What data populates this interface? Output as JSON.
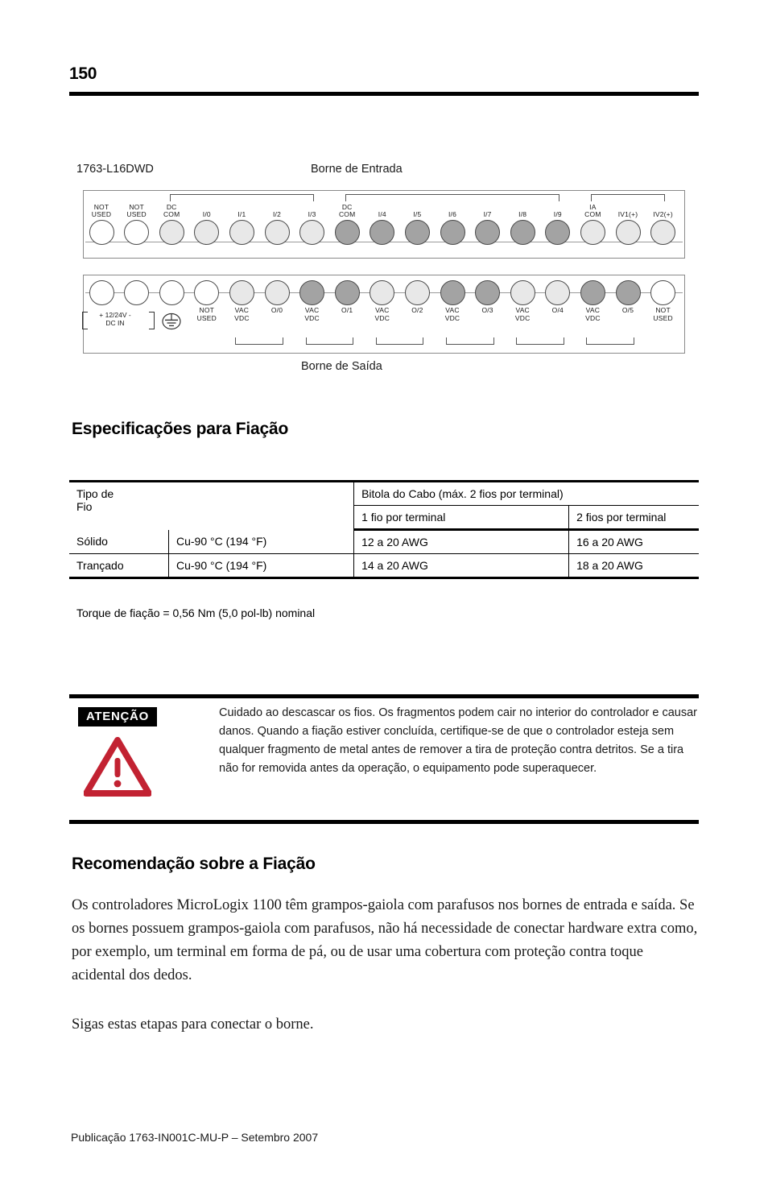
{
  "page": {
    "number": "150",
    "footer": "Publicação 1763-IN001C-MU-P – Setembro 2007"
  },
  "diagram": {
    "model": "1763-L16DWD",
    "input_row_label": "Borne de Entrada",
    "output_row_label": "Borne de Saída",
    "colors": {
      "white": "#ffffff",
      "light": "#e8e8e8",
      "dark": "#a3a3a3",
      "outline": "#4a4a4a"
    },
    "input_terminals": [
      {
        "label": "NOT\nUSED",
        "fill": "white"
      },
      {
        "label": "NOT\nUSED",
        "fill": "white"
      },
      {
        "label": "DC\nCOM",
        "fill": "light"
      },
      {
        "label": "I/0",
        "fill": "light"
      },
      {
        "label": "I/1",
        "fill": "light"
      },
      {
        "label": "I/2",
        "fill": "light"
      },
      {
        "label": "I/3",
        "fill": "light"
      },
      {
        "label": "DC\nCOM",
        "fill": "dark"
      },
      {
        "label": "I/4",
        "fill": "dark"
      },
      {
        "label": "I/5",
        "fill": "dark"
      },
      {
        "label": "I/6",
        "fill": "dark"
      },
      {
        "label": "I/7",
        "fill": "dark"
      },
      {
        "label": "I/8",
        "fill": "dark"
      },
      {
        "label": "I/9",
        "fill": "dark"
      },
      {
        "label": "IA\nCOM",
        "fill": "light"
      },
      {
        "label": "IV1(+)",
        "fill": "light"
      },
      {
        "label": "IV2(+)",
        "fill": "light"
      }
    ],
    "output_terminals": [
      {
        "label": "",
        "fill": "white"
      },
      {
        "label": "",
        "fill": "white"
      },
      {
        "label": "",
        "fill": "white"
      },
      {
        "label": "NOT\nUSED",
        "fill": "white"
      },
      {
        "label": "VAC\nVDC",
        "fill": "light"
      },
      {
        "label": "O/0",
        "fill": "light"
      },
      {
        "label": "VAC\nVDC",
        "fill": "dark"
      },
      {
        "label": "O/1",
        "fill": "dark"
      },
      {
        "label": "VAC\nVDC",
        "fill": "light"
      },
      {
        "label": "O/2",
        "fill": "light"
      },
      {
        "label": "VAC\nVDC",
        "fill": "dark"
      },
      {
        "label": "O/3",
        "fill": "dark"
      },
      {
        "label": "VAC\nVDC",
        "fill": "light"
      },
      {
        "label": "O/4",
        "fill": "light"
      },
      {
        "label": "VAC\nVDC",
        "fill": "dark"
      },
      {
        "label": "O/5",
        "fill": "dark"
      },
      {
        "label": "NOT\nUSED",
        "fill": "white"
      }
    ],
    "power_label": "+ 12/24V -\nDC IN"
  },
  "wiring_specs": {
    "heading": "Especificações para Fiação",
    "col_group_header": "Bitola do Cabo (máx. 2 fios por terminal)",
    "row_header": "Tipo de\nFio",
    "subheaders": [
      "1 fio por terminal",
      "2 fios por terminal"
    ],
    "rows": [
      {
        "type": "Sólido",
        "rating": "Cu-90 °C (194 °F)",
        "one_wire": "12 a 20 AWG",
        "two_wire": "16 a 20 AWG"
      },
      {
        "type": "Trançado",
        "rating": "Cu-90 °C (194 °F)",
        "one_wire": "14 a 20 AWG",
        "two_wire": "18 a 20 AWG"
      }
    ],
    "torque_note": "Torque de fiação = 0,56 Nm (5,0 pol-lb) nominal"
  },
  "attention": {
    "badge": "ATENÇÃO",
    "accent_color": "#c22232",
    "text": "Cuidado ao descascar os fios. Os fragmentos podem cair no interior do controlador e causar danos. Quando a fiação estiver concluída, certifique-se de que o controlador esteja sem qualquer fragmento de metal antes de remover a tira de proteção contra detritos. Se a tira não for removida antes da operação, o equipamento pode superaquecer."
  },
  "recommendation": {
    "heading": "Recomendação sobre a Fiação",
    "paragraph1": "Os controladores MicroLogix 1100 têm grampos-gaiola com parafusos nos bornes de entrada e saída. Se os bornes possuem grampos-gaiola com parafusos, não há necessidade de conectar hardware extra como, por exemplo, um terminal em forma de pá, ou de usar uma cobertura com proteção contra toque acidental dos dedos.",
    "paragraph2": "Sigas estas etapas para conectar o borne."
  }
}
